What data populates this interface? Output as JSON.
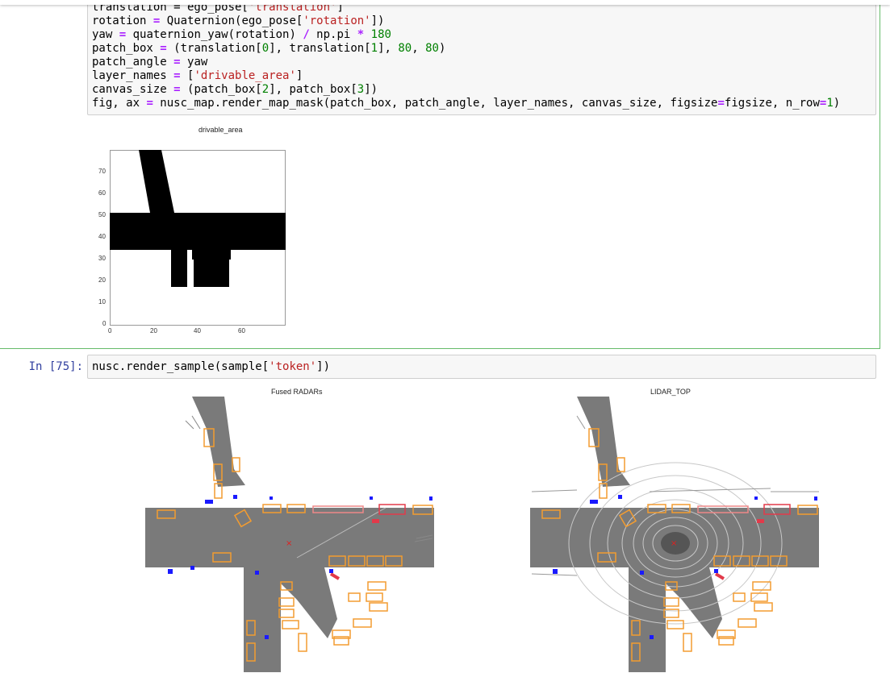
{
  "code_cell_1": {
    "lines": [
      "translation = ego_pose['translation']",
      "rotation = Quaternion(ego_pose['rotation'])",
      "yaw = quaternion_yaw(rotation) / np.pi * 180",
      "patch_box = (translation[0], translation[1], 80, 80)",
      "patch_angle = yaw",
      "layer_names = ['drivable_area']",
      "canvas_size = (patch_box[2], patch_box[3])",
      "fig, ax = nusc_map.render_map_mask(patch_box, patch_angle, layer_names, canvas_size, figsize=figsize, n_row=1)"
    ]
  },
  "mask_plot": {
    "title": "drivable_area",
    "y_ticks": [
      "70",
      "60",
      "50",
      "40",
      "30",
      "20",
      "10",
      "0"
    ],
    "x_ticks": [
      "0",
      "20",
      "40",
      "60"
    ]
  },
  "code_cell_2": {
    "prompt": "In [75]:",
    "code": "nusc.render_sample(sample['token'])"
  },
  "render_sample": {
    "left_title": "Fused RADARs",
    "right_title": "LIDAR_TOP"
  },
  "colors": {
    "road": "#7a7a7a",
    "box_orange": "#f39c30",
    "box_red": "#e23a4a",
    "radar_blue": "#1a1aff",
    "ego_marker": "#e02020"
  }
}
